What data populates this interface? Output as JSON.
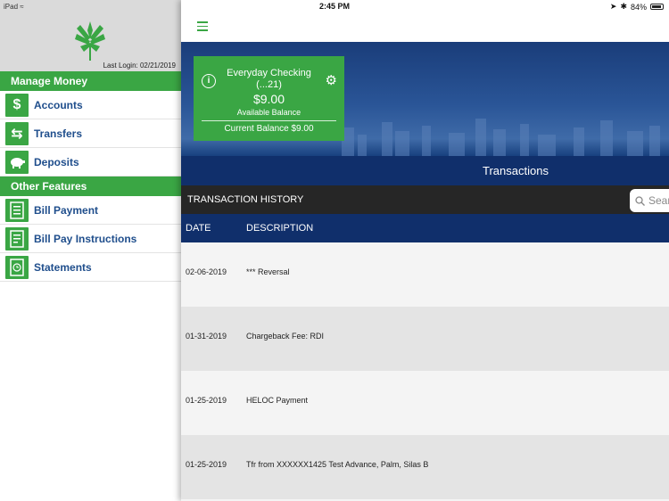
{
  "status_bar": {
    "device": "iPad",
    "time": "2:45 PM",
    "battery": "84%"
  },
  "sidebar": {
    "last_login": "Last Login:  02/21/2019",
    "sections": [
      {
        "title": "Manage Money",
        "items": [
          {
            "label": "Accounts",
            "icon": "dollar-icon"
          },
          {
            "label": "Transfers",
            "icon": "transfer-arrows-icon"
          },
          {
            "label": "Deposits",
            "icon": "piggy-bank-icon"
          }
        ]
      },
      {
        "title": "Other Features",
        "items": [
          {
            "label": "Bill Payment",
            "icon": "bill-document-icon"
          },
          {
            "label": "Bill Pay Instructions",
            "icon": "instructions-document-icon"
          },
          {
            "label": "Statements",
            "icon": "statement-document-icon"
          }
        ]
      }
    ]
  },
  "account_card": {
    "name": "Everyday Checking",
    "number": "(...21)",
    "amount": "$9.00",
    "available_label": "Available Balance",
    "current_balance": "Current Balance $9.00"
  },
  "transactions": {
    "title": "Transactions",
    "history_label": "TRANSACTION HISTORY",
    "search_placeholder": "Sear",
    "columns": {
      "date": "DATE",
      "description": "DESCRIPTION"
    },
    "rows": [
      {
        "date": "02-06-2019",
        "description": "*** Reversal"
      },
      {
        "date": "01-31-2019",
        "description": "Chargeback Fee: RDI"
      },
      {
        "date": "01-25-2019",
        "description": "HELOC Payment"
      },
      {
        "date": "01-25-2019",
        "description": "Tfr from XXXXXX1425 Test Advance, Palm, Silas B"
      }
    ]
  },
  "colors": {
    "brand_green": "#3aa644",
    "navy": "#102f6b",
    "link_blue": "#1f4e8c"
  }
}
